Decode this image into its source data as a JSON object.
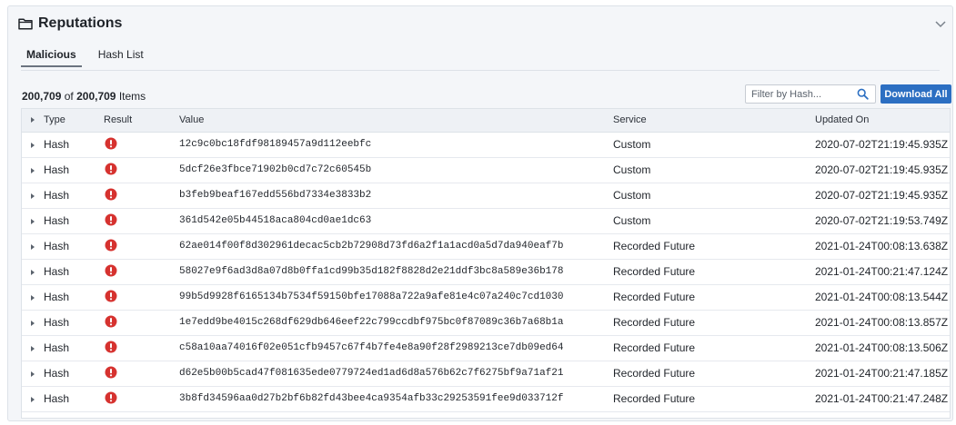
{
  "panel": {
    "title": "Reputations",
    "folder_icon": "folder-icon",
    "collapse_icon": "chevron-down-icon"
  },
  "tabs": [
    {
      "label": "Malicious",
      "active": true
    },
    {
      "label": "Hash List",
      "active": false
    }
  ],
  "count": {
    "shown": "200,709",
    "of": "of",
    "total": "200,709",
    "suffix": "Items"
  },
  "filter": {
    "placeholder": "Filter by Hash...",
    "value": "",
    "icon": "search-icon"
  },
  "download_button": "Download All",
  "colors": {
    "accent": "#2c6fc2",
    "alert": "#d6322f"
  },
  "table": {
    "headers": [
      "Type",
      "Result",
      "Value",
      "Service",
      "Updated On"
    ],
    "rows": [
      {
        "type": "Hash",
        "result_icon": "alert-icon",
        "value": "12c9c0bc18fdf98189457a9d112eebfc",
        "service": "Custom",
        "updated": "2020-07-02T21:19:45.935Z"
      },
      {
        "type": "Hash",
        "result_icon": "alert-icon",
        "value": "5dcf26e3fbce71902b0cd7c72c60545b",
        "service": "Custom",
        "updated": "2020-07-02T21:19:45.935Z"
      },
      {
        "type": "Hash",
        "result_icon": "alert-icon",
        "value": "b3feb9beaf167edd556bd7334e3833b2",
        "service": "Custom",
        "updated": "2020-07-02T21:19:45.935Z"
      },
      {
        "type": "Hash",
        "result_icon": "alert-icon",
        "value": "361d542e05b44518aca804cd0ae1dc63",
        "service": "Custom",
        "updated": "2020-07-02T21:19:53.749Z"
      },
      {
        "type": "Hash",
        "result_icon": "alert-icon",
        "value": "62ae014f00f8d302961decac5cb2b72908d73fd6a2f1a1acd0a5d7da940eaf7b",
        "service": "Recorded Future",
        "updated": "2021-01-24T00:08:13.638Z"
      },
      {
        "type": "Hash",
        "result_icon": "alert-icon",
        "value": "58027e9f6ad3d8a07d8b0ffa1cd99b35d182f8828d2e21ddf3bc8a589e36b178",
        "service": "Recorded Future",
        "updated": "2021-01-24T00:21:47.124Z"
      },
      {
        "type": "Hash",
        "result_icon": "alert-icon",
        "value": "99b5d9928f6165134b7534f59150bfe17088a722a9afe81e4c07a240c7cd1030",
        "service": "Recorded Future",
        "updated": "2021-01-24T00:08:13.544Z"
      },
      {
        "type": "Hash",
        "result_icon": "alert-icon",
        "value": "1e7edd9be4015c268df629db646eef22c799ccdbf975bc0f87089c36b7a68b1a",
        "service": "Recorded Future",
        "updated": "2021-01-24T00:08:13.857Z"
      },
      {
        "type": "Hash",
        "result_icon": "alert-icon",
        "value": "c58a10aa74016f02e051cfb9457c67f4b7fe4e8a90f28f2989213ce7db09ed64",
        "service": "Recorded Future",
        "updated": "2021-01-24T00:08:13.506Z"
      },
      {
        "type": "Hash",
        "result_icon": "alert-icon",
        "value": "d62e5b00b5cad47f081635ede0779724ed1ad6d8a576b62c7f6275bf9a71af21",
        "service": "Recorded Future",
        "updated": "2021-01-24T00:21:47.185Z"
      },
      {
        "type": "Hash",
        "result_icon": "alert-icon",
        "value": "3b8fd34596aa0d27b2bf6b82fd43bee4ca9354afb33c29253591fee9d033712f",
        "service": "Recorded Future",
        "updated": "2021-01-24T00:21:47.248Z"
      }
    ]
  }
}
